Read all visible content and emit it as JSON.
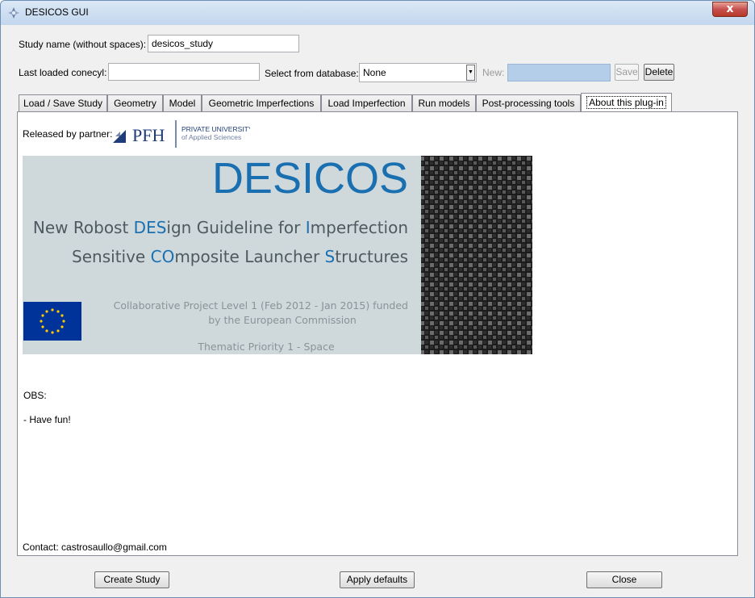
{
  "window": {
    "title": "DESICOS GUI",
    "close_glyph": "x",
    "app_icon": "desicos-app-icon"
  },
  "study_name": {
    "label": "Study name (without spaces):",
    "value": "desicos_study"
  },
  "conecyl": {
    "label": "Last loaded conecyl:",
    "value": ""
  },
  "database": {
    "label": "Select from database:",
    "selected": "None"
  },
  "new_field": {
    "label": "New:",
    "value": ""
  },
  "buttons": {
    "save": "Save",
    "delete": "Delete",
    "create_study": "Create Study",
    "apply_defaults": "Apply defaults",
    "close": "Close"
  },
  "tabs": [
    {
      "label": "Load / Save Study"
    },
    {
      "label": "Geometry"
    },
    {
      "label": "Model"
    },
    {
      "label": "Geometric Imperfections"
    },
    {
      "label": "Load Imperfection"
    },
    {
      "label": "Run models"
    },
    {
      "label": "Post-processing tools"
    },
    {
      "label": "About this plug-in",
      "active": true
    }
  ],
  "about": {
    "partner_label": "Released by partner:",
    "pfh_logo": {
      "name": "PFH",
      "line1": "PRIVATE UNIVERSITY",
      "line2": "of Applied Sciences"
    },
    "banner": {
      "title": "DESICOS",
      "line1_parts": [
        "New Robost ",
        "DES",
        "ign Guideline for ",
        "I",
        "mperfection"
      ],
      "line2_parts": [
        "Sensitive ",
        "CO",
        "mposite Launcher ",
        "S",
        "tructures"
      ],
      "project_line1": "Collaborative Project Level 1 (Feb 2012 - Jan 2015) funded",
      "project_line2": "by the European Commission",
      "thematic": "Thematic Priority 1 - Space"
    },
    "obs": "OBS:",
    "note": "- Have fun!",
    "contact": "Contact: castrosaullo@gmail.com"
  },
  "colors": {
    "accent_blue": "#1a6fb0",
    "banner_bg": "#cfd9dc",
    "banner_grey_text": "#4d5a60",
    "banner_small_text": "#8a9396",
    "eu_blue": "#003399",
    "eu_star": "#ffcc00",
    "pfh_blue": "#1d3c78",
    "new_field_bg": "#b4cde9"
  }
}
